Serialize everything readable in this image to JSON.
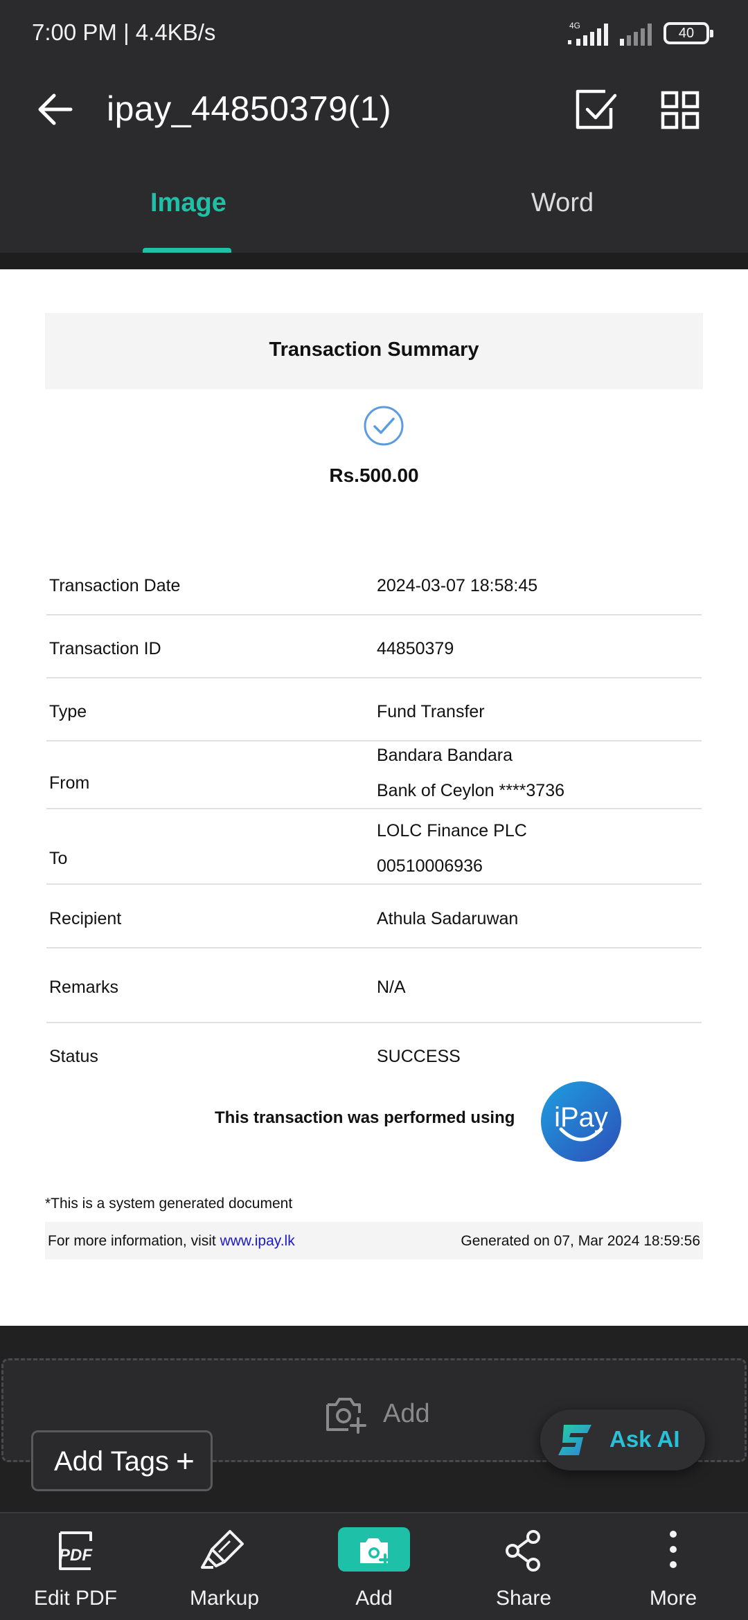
{
  "status_bar": {
    "time_speed": "7:00 PM | 4.4KB/s",
    "network_type": "4G",
    "battery": "40"
  },
  "header": {
    "title": "ipay_44850379(1)",
    "back_icon": "arrow-left-icon",
    "select_icon": "checkbox-select-icon",
    "grid_icon": "grid-view-icon",
    "tabs": [
      {
        "label": "Image",
        "active": true
      },
      {
        "label": "Word",
        "active": false
      }
    ],
    "accent_color": "#1ec1a8"
  },
  "document": {
    "summary_title": "Transaction Summary",
    "amount": "Rs.500.00",
    "rows": [
      {
        "label": "Transaction Date",
        "value": "2024-03-07 18:58:45"
      },
      {
        "label": "Transaction ID",
        "value": "44850379"
      },
      {
        "label": "Type",
        "value": "Fund Transfer"
      },
      {
        "label": "From",
        "value": "Bandara Bandara",
        "value2": "Bank of Ceylon ****3736"
      },
      {
        "label": "To",
        "value": "LOLC Finance PLC",
        "value2": "00510006936"
      },
      {
        "label": "Recipient",
        "value": "Athula Sadaruwan"
      },
      {
        "label": "Remarks",
        "value": "N/A"
      },
      {
        "label": "Status",
        "value": "SUCCESS"
      }
    ],
    "performed_text": "This transaction was performed using",
    "logo_text": "iPay",
    "system_note": "*This is a system generated document",
    "footer_info_prefix": "For more information, visit ",
    "footer_link": "www.ipay.lk",
    "generated_on": "Generated on 07, Mar 2024 18:59:56"
  },
  "add_area": {
    "label": "Add",
    "icon": "add-photo-icon"
  },
  "tags": {
    "label": "Add Tags",
    "plus": "+"
  },
  "ask_ai": {
    "label": "Ask AI",
    "color": "#28c2d8"
  },
  "toolbar": {
    "items": [
      {
        "label": "Edit PDF",
        "icon": "pdf-edit-icon"
      },
      {
        "label": "Markup",
        "icon": "highlighter-icon"
      },
      {
        "label": "Add",
        "icon": "add-photo-icon"
      },
      {
        "label": "Share",
        "icon": "share-icon"
      },
      {
        "label": "More",
        "icon": "more-vertical-icon"
      }
    ]
  }
}
